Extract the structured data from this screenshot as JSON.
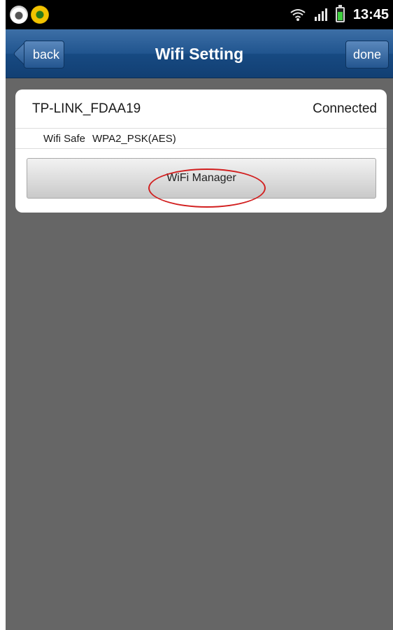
{
  "status_bar": {
    "time": "13:45",
    "icons": [
      "camera-app-icon",
      "notification-icon",
      "wifi-icon",
      "signal-icon",
      "battery-icon"
    ]
  },
  "nav": {
    "title": "Wifi Setting",
    "back_label": "back",
    "done_label": "done"
  },
  "wifi": {
    "ssid": "TP-LINK_FDAA19",
    "status": "Connected",
    "security_label": "Wifi Safe",
    "security_value": "WPA2_PSK(AES)",
    "manager_button_label": "WiFi Manager"
  },
  "colors": {
    "navbar": "#1c4f88",
    "background": "#666666",
    "annotation": "#d21f1f",
    "battery": "#3fd13f"
  }
}
